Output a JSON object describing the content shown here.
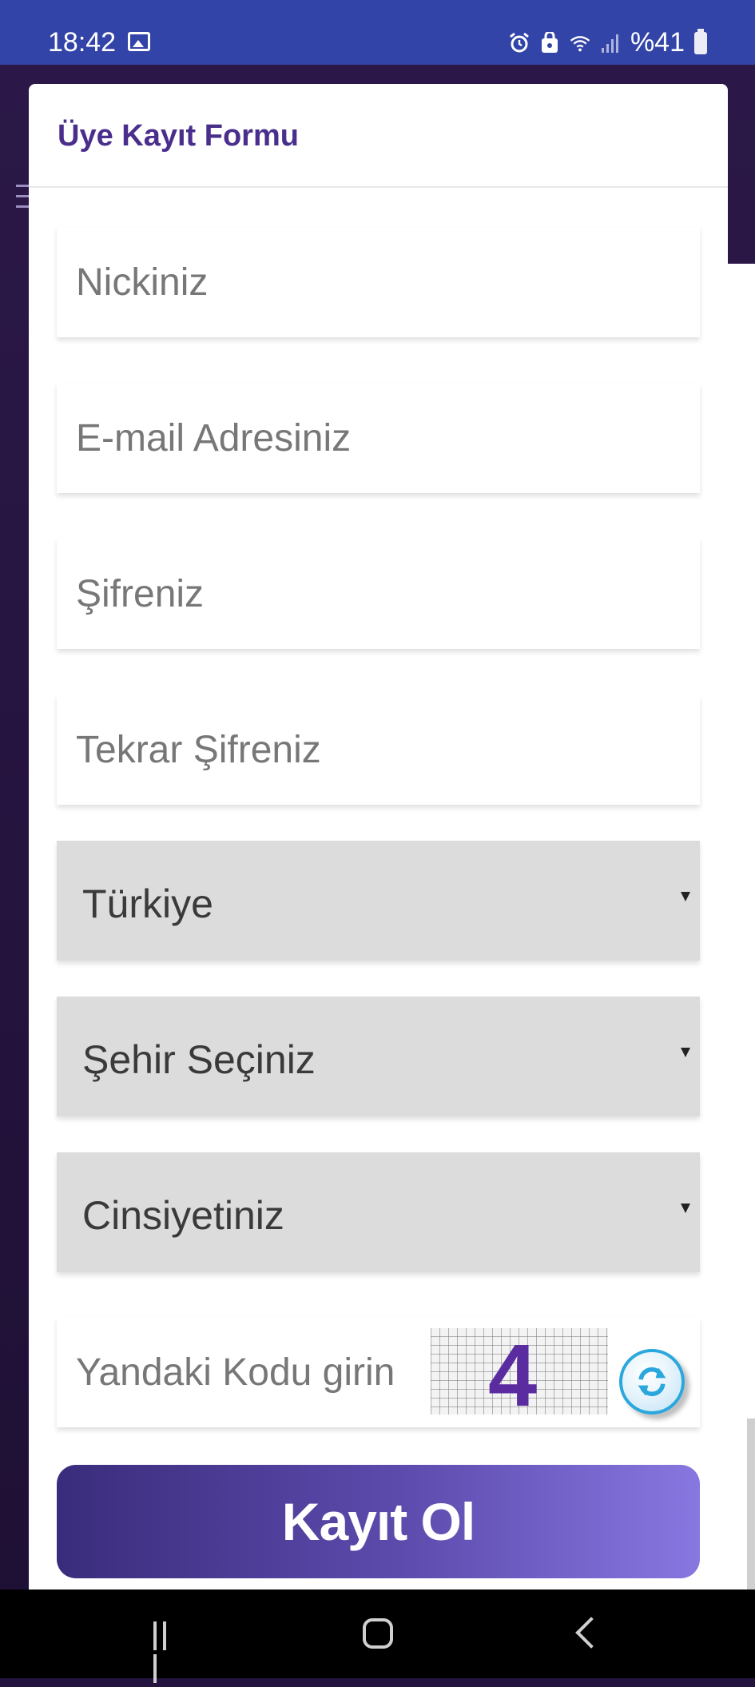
{
  "status_bar": {
    "time": "18:42",
    "battery": "%41"
  },
  "modal": {
    "title": "Üye Kayıt Formu",
    "fields": {
      "nick_placeholder": "Nickiniz",
      "email_placeholder": "E-mail Adresiniz",
      "password_placeholder": "Şifreniz",
      "password_repeat_placeholder": "Tekrar Şifreniz"
    },
    "selects": {
      "country": "Türkiye",
      "city": "Şehir Seçiniz",
      "gender": "Cinsiyetiniz"
    },
    "captcha": {
      "placeholder": "Yandaki Kodu girin",
      "code": "4"
    },
    "submit_label": "Kayıt Ol"
  },
  "colors": {
    "status_bar": "#3344a8",
    "title": "#4a2e8c",
    "button_start": "#3a2c7c",
    "button_end": "#8777e0",
    "select_bg": "#dcdcdc"
  }
}
